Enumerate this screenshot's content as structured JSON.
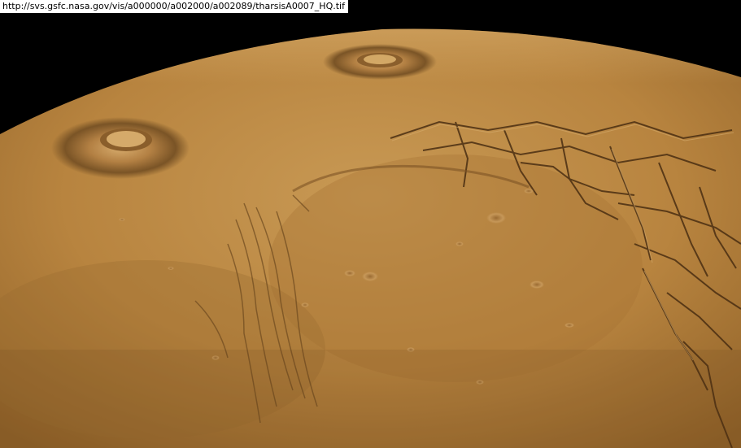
{
  "image": {
    "url_label": "http://svs.gsfc.nasa.gov/vis/a000000/a002000/a002089/tharsisA0007_HQ.tif"
  },
  "colors": {
    "space": "#000000",
    "surface_light": "#c99a57",
    "surface_mid": "#b07f40",
    "surface_dark": "#8a5f2c",
    "shadow": "#4a2e12"
  }
}
